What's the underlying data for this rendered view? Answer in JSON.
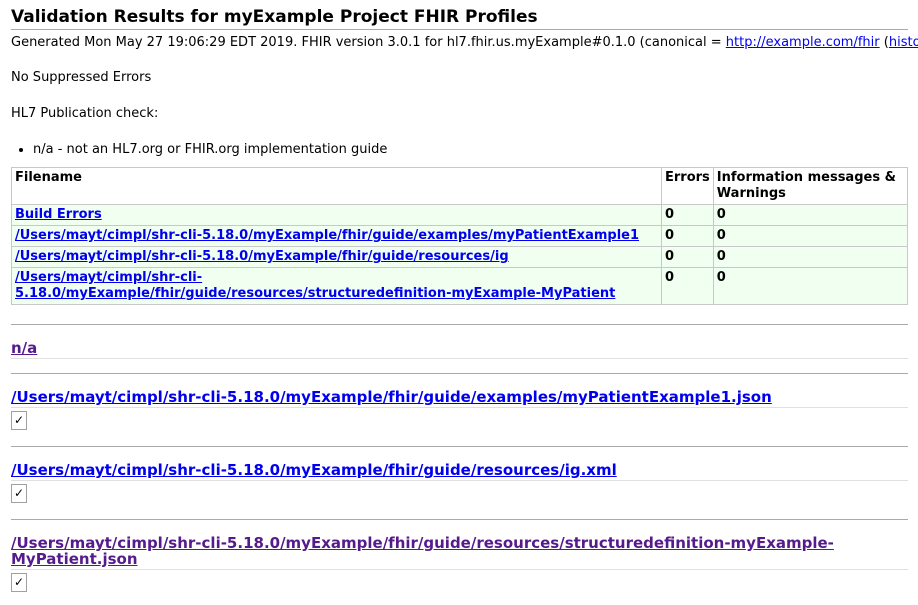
{
  "title": "Validation Results for myExample Project FHIR Profiles",
  "generated": {
    "prefix": "Generated Mon May 27 19:06:29 EDT 2019. FHIR version 3.0.1 for hl7.fhir.us.myExample#0.1.0 (canonical = ",
    "canonical_link": "http://example.com/fhir",
    "mid": " (",
    "history_link": "history",
    "suffix": "))"
  },
  "suppressed": "No Suppressed Errors",
  "publication_check": "HL7 Publication check:",
  "publication_items": [
    "n/a - not an HL7.org or FHIR.org implementation guide"
  ],
  "table": {
    "headers": [
      "Filename",
      "Errors",
      "Information messages & Warnings"
    ],
    "rows": [
      {
        "file": "Build Errors",
        "errors": "0",
        "info": "0"
      },
      {
        "file": "/Users/mayt/cimpl/shr-cli-5.18.0/myExample/fhir/guide/examples/myPatientExample1",
        "errors": "0",
        "info": "0"
      },
      {
        "file": "/Users/mayt/cimpl/shr-cli-5.18.0/myExample/fhir/guide/resources/ig",
        "errors": "0",
        "info": "0"
      },
      {
        "file": "/Users/mayt/cimpl/shr-cli-5.18.0/myExample/fhir/guide/resources/structuredefinition-myExample-MyPatient",
        "errors": "0",
        "info": "0"
      }
    ]
  },
  "sections": [
    {
      "heading": "n/a",
      "check": ""
    },
    {
      "heading": "/Users/mayt/cimpl/shr-cli-5.18.0/myExample/fhir/guide/examples/myPatientExample1.json",
      "check": "✓"
    },
    {
      "heading": "/Users/mayt/cimpl/shr-cli-5.18.0/myExample/fhir/guide/resources/ig.xml",
      "check": "✓"
    },
    {
      "heading": "/Users/mayt/cimpl/shr-cli-5.18.0/myExample/fhir/guide/resources/structuredefinition-myExample-MyPatient.json",
      "check": "✓"
    }
  ]
}
